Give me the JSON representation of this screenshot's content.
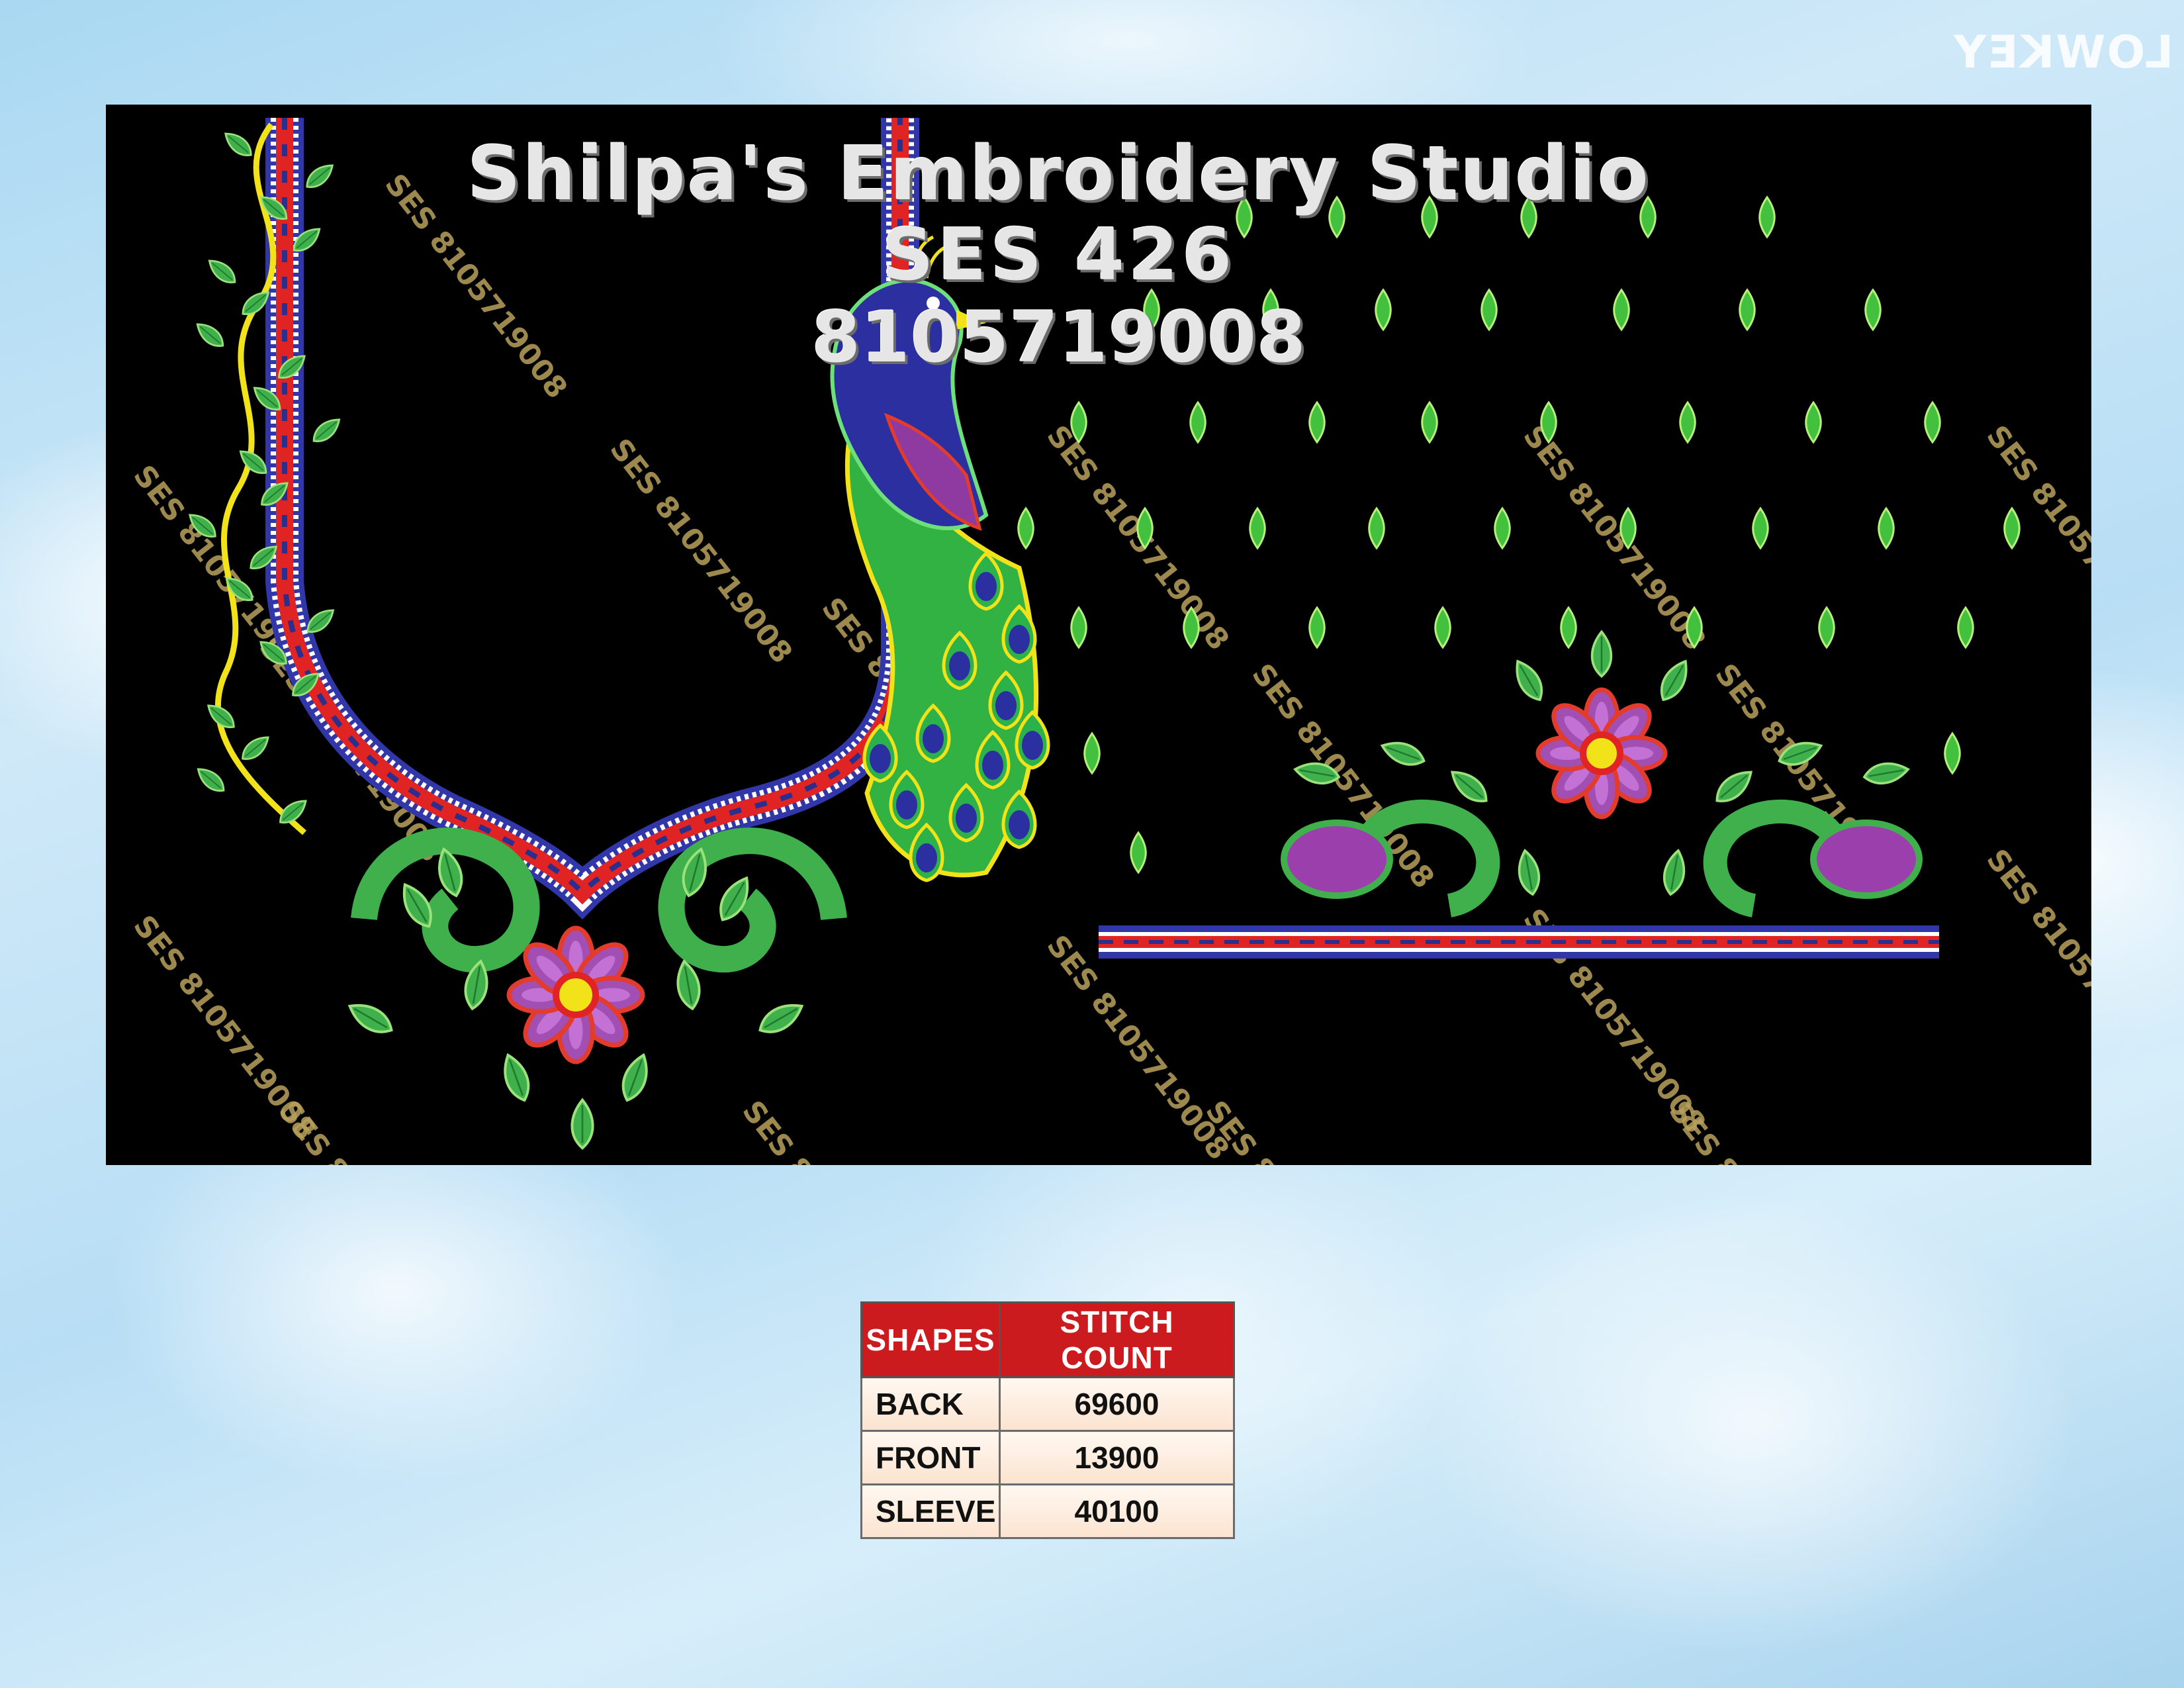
{
  "header": {
    "studio_name": "Shilpa's Embroidery Studio",
    "design_code": "SES 426",
    "phone": "8105719008"
  },
  "watermark": {
    "text": "SES 8105719008",
    "corner_mark": "LOWKEY"
  },
  "colors": {
    "panel_background": "#000000",
    "table_header": "#cc1b1e",
    "leaf_green": "#39b54a",
    "flower_purple": "#8e3a9d",
    "accent_red": "#e02020",
    "accent_yellow": "#f2e21a",
    "peacock_blue": "#2b2f9e"
  },
  "icons": {
    "neckline": "embroidered-neckline-icon",
    "peacock": "peacock-motif-icon",
    "flower_center": "flower-motif-icon",
    "leaf_drops": "leaf-drop-icon"
  },
  "stitch_table": {
    "headers": [
      "SHAPES",
      "STITCH COUNT"
    ],
    "rows": [
      {
        "shape": "BACK",
        "count": "69600"
      },
      {
        "shape": "FRONT",
        "count": "13900"
      },
      {
        "shape": "SLEEVE",
        "count": "40100"
      }
    ]
  }
}
